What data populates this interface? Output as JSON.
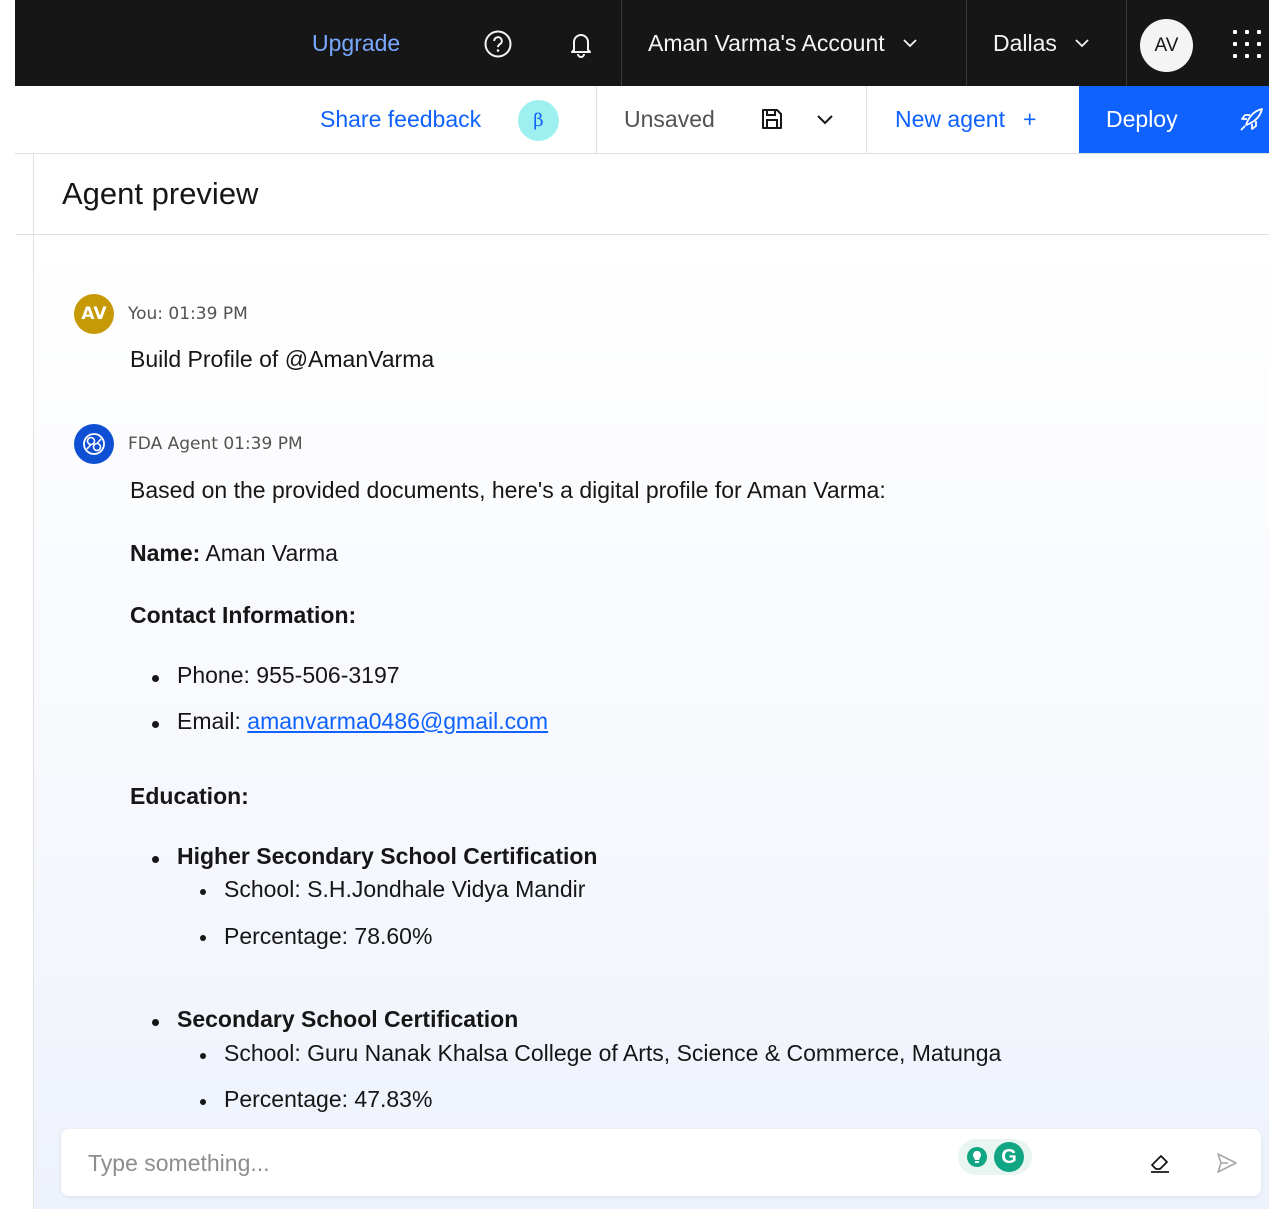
{
  "header": {
    "upgrade_label": "Upgrade",
    "account_label": "Aman Varma's Account",
    "region_label": "Dallas",
    "avatar_initials": "AV",
    "icons": [
      "help-icon",
      "notification-icon",
      "chevron-down-icon",
      "app-switcher-icon"
    ]
  },
  "toolbar": {
    "feedback_label": "Share feedback",
    "beta_badge": "β",
    "status_label": "Unsaved",
    "new_agent_label": "New agent",
    "new_agent_plus": "+",
    "deploy_label": "Deploy",
    "icons": [
      "save-icon",
      "chevron-down-icon",
      "rocket-icon"
    ]
  },
  "panel": {
    "title": "Agent preview"
  },
  "messages": [
    {
      "avatar": "AV",
      "header": "You: 01:39 PM",
      "text": "Build Profile of @AmanVarma"
    },
    {
      "avatar_icon": "agent-icon",
      "header": "FDA Agent 01:39 PM",
      "intro": "Based on the provided documents, here's a digital profile for Aman Varma:",
      "name_label": "Name:",
      "name_value": " Aman Varma",
      "contact_heading": "Contact Information:",
      "phone": "Phone: 955-506-3197",
      "email_prefix": "Email: ",
      "email": "amanvarma0486@gmail.com",
      "education_heading": "Education:",
      "education": [
        {
          "title": "Higher Secondary School Certification",
          "school": "School: S.H.Jondhale Vidya Mandir",
          "percentage": "Percentage: 78.60%"
        },
        {
          "title": "Secondary School Certification",
          "school": "School: Guru Nanak Khalsa College of Arts, Science & Commerce, Matunga",
          "percentage": "Percentage: 47.83%"
        }
      ]
    }
  ],
  "input": {
    "placeholder": "Type something...",
    "grammarly_letter": "G",
    "icons": [
      "lightbulb-icon",
      "eraser-icon",
      "send-icon"
    ]
  },
  "colors": {
    "header_bg": "#161616",
    "accent": "#0f62fe",
    "upgrade_link": "#78a9ff",
    "user_avatar": "#c69a06",
    "agent_avatar": "#0f4fd4",
    "beta_badge": "#9ef0f0"
  }
}
